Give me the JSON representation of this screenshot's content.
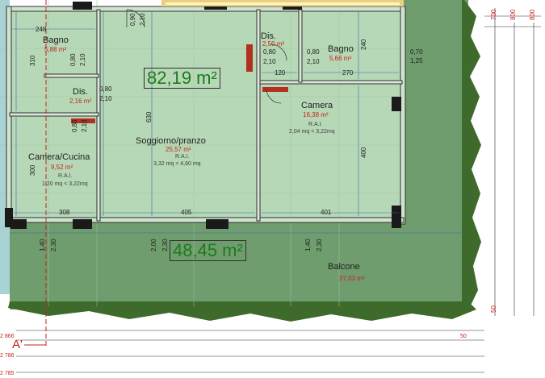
{
  "floorplan": {
    "total_area": "82,19 m²",
    "balcony_area": "48,45 m²",
    "section_label": "A'",
    "rooms": {
      "bagno1": {
        "name": "Bagno",
        "area": "5,88 m²"
      },
      "dis1": {
        "name": "Dis.",
        "area": "2,16 m²"
      },
      "camera_cucina": {
        "name": "Camera/Cucina",
        "area": "9,52 m²",
        "rai_label": "R.A.I.",
        "rai_value": "1,20 mq < 3,22mq"
      },
      "soggiorno": {
        "name": "Soggiorno/pranzo",
        "area": "25,57 m²",
        "rai_label": "R.A.I.",
        "rai_value": "3,32 mq < 4,60 mq"
      },
      "dis2": {
        "name": "Dis.",
        "area": "2,50 m²"
      },
      "bagno2": {
        "name": "Bagno",
        "area": "5,66 m²"
      },
      "camera": {
        "name": "Camera",
        "area": "16,38 m²",
        "rai_label": "R.A.I.",
        "rai_value": "2,04 mq < 3,22mq"
      },
      "balcone": {
        "name": "Balcone",
        "area": "37,03 m²"
      }
    },
    "openings": {
      "top_door": [
        "0,90",
        "2,10"
      ],
      "bagno1_window": [
        "0,80",
        "2,10"
      ],
      "dis1_door": [
        "0,80",
        "2,10"
      ],
      "camera_cucina_door": [
        "0,80",
        "2,10"
      ],
      "dis2_door": [
        "0,80",
        "2,10"
      ],
      "bagno2_door": [
        "0,80",
        "2,10"
      ],
      "right_window": [
        "0,70",
        "1,25"
      ],
      "left_french": [
        "1,40",
        "2,30"
      ],
      "mid_french": [
        "2,00",
        "2,30"
      ],
      "right_french": [
        "1,40",
        "2,30"
      ]
    },
    "dimensions": {
      "bagno1_width": "248",
      "bagno1_height": "310",
      "camera_cucina_width": "308",
      "camera_cucina_height": "300",
      "soggiorno_width": "405",
      "soggiorno_height": "630",
      "dis2_width": "120",
      "bagno2_width": "270",
      "bagno2_height": "240",
      "camera_width": "401",
      "camera_height": "400",
      "right_800_a": "800",
      "right_800_b": "800",
      "right_700": "700",
      "right_50": "50",
      "bottom_50": "50",
      "bottom_866": "2 866",
      "bottom_2786": "2 786",
      "bottom_2785": "2 785"
    }
  }
}
